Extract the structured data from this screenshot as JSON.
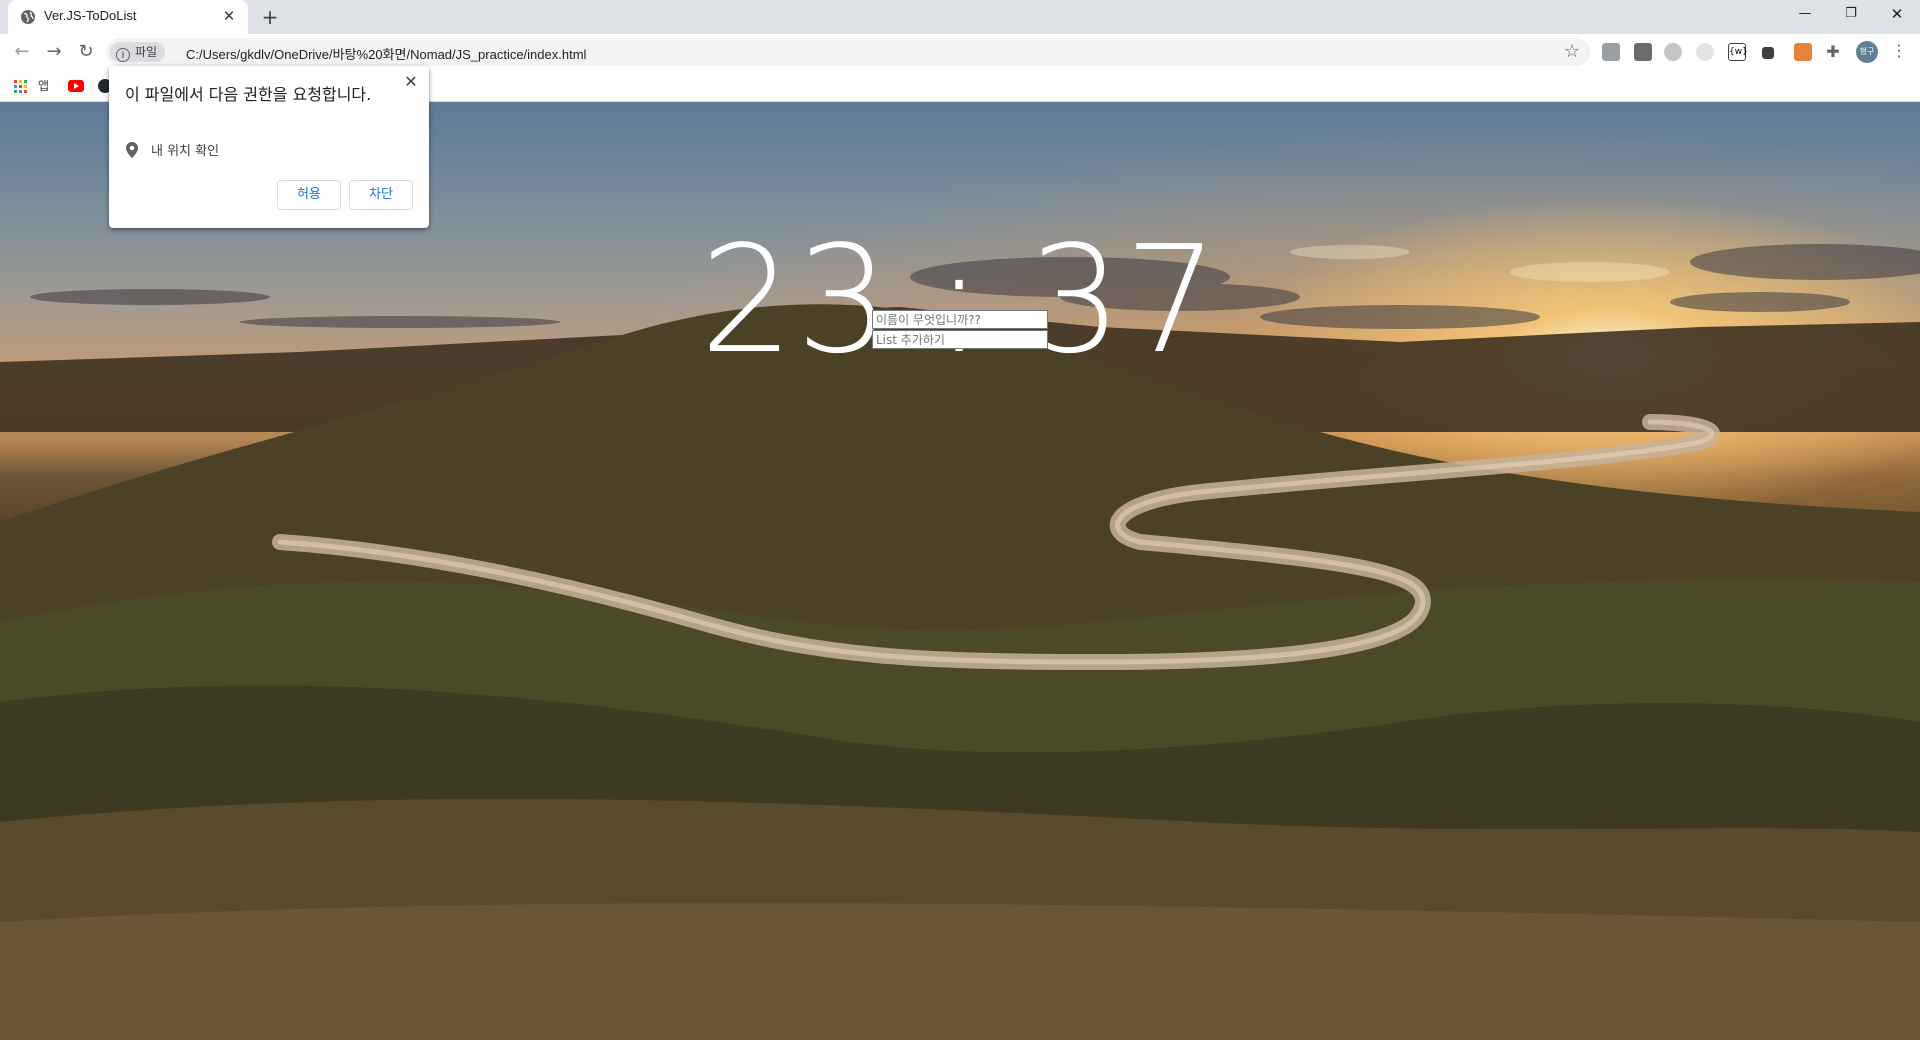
{
  "browser": {
    "tab": {
      "title": "Ver.JS-ToDoList"
    },
    "address_bar": {
      "chip_label": "파일",
      "url": "C:/Users/gkdlv/OneDrive/바탕%20화면/Nomad/JS_practice/index.html"
    },
    "profile_avatar": "형구"
  },
  "bookmarks": {
    "apps_label": "앱"
  },
  "permission_popup": {
    "title": "이 파일에서 다음 권한을 요청합니다.",
    "item": "내 위치 확인",
    "allow_label": "허용",
    "block_label": "차단"
  },
  "page": {
    "clock": {
      "hours": "23",
      "separator": ":",
      "minutes": "37"
    },
    "name_input": {
      "placeholder": "이름이 무엇입니까??"
    },
    "todo_input": {
      "placeholder": "List 추가하기"
    }
  },
  "colors": {
    "accent": "#1a73e8",
    "tabstrip": "#dee1e6"
  }
}
